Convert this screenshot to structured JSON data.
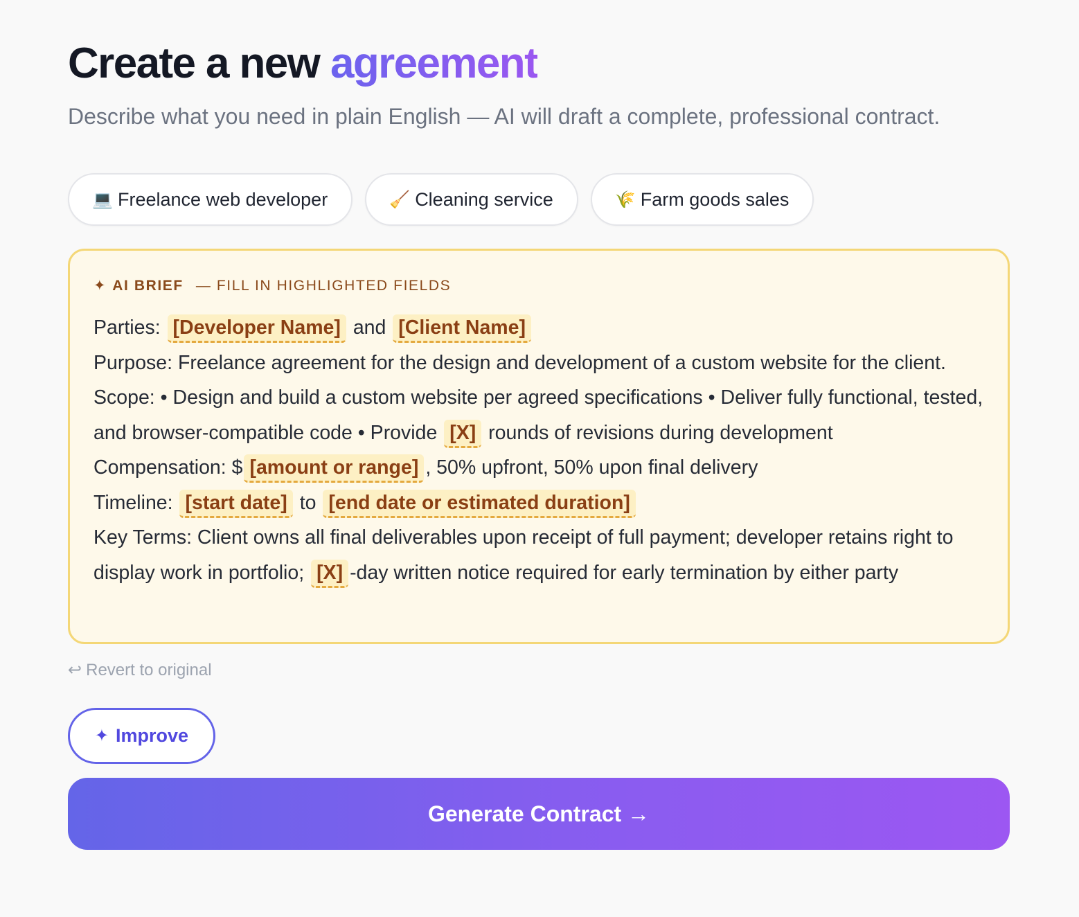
{
  "header": {
    "title_prefix": "Create a new",
    "title_accent": "agreement",
    "subtitle": "Describe what you need in plain English — AI will draft a complete, professional contract."
  },
  "chips": [
    {
      "emoji": "💻",
      "icon": "laptop-icon",
      "label": "Freelance web developer"
    },
    {
      "emoji": "🧹",
      "icon": "broom-icon",
      "label": "Cleaning service"
    },
    {
      "emoji": "🌾",
      "icon": "wheat-icon",
      "label": "Farm goods sales"
    }
  ],
  "brief": {
    "sparkle": "✦",
    "tag": "AI BRIEF",
    "note": "— FILL IN HIGHLIGHTED FIELDS",
    "parties": {
      "label": "Parties:",
      "developer": "[Developer Name]",
      "and": "and",
      "client": "[Client Name]"
    },
    "purpose": {
      "text": "Purpose: Freelance agreement for the design and development of a custom website for the client."
    },
    "scope": {
      "text_before": "Scope: • Design and build a custom website per agreed specifications • Deliver fully functional, tested, and browser-compatible code • Provide",
      "revisions": "[X]",
      "text_after": "rounds of revisions during development"
    },
    "compensation": {
      "label": "Compensation: $",
      "amount": "[amount or range]",
      "text_after": ", 50% upfront, 50% upon final delivery"
    },
    "timeline": {
      "label": "Timeline:",
      "start": "[start date]",
      "to": "to",
      "end": "[end date or estimated duration]"
    },
    "key_terms": {
      "text_before": "Key Terms: Client owns all final deliverables upon receipt of full payment; developer retains right to display work in portfolio;",
      "notice_days": "[X]",
      "text_after": "-day written notice required for early termination by either party"
    }
  },
  "actions": {
    "revert_arrow": "↩",
    "revert_label": "Revert to original",
    "improve_icon": "✦",
    "improve_label": "Improve",
    "generate_label": "Generate Contract →"
  },
  "colors": {
    "accent_start": "#6c63ee",
    "accent_end": "#9a57f0",
    "brief_bg": "#fef9ea",
    "brief_border": "#f4d777",
    "placeholder_text": "#8a3f14"
  }
}
